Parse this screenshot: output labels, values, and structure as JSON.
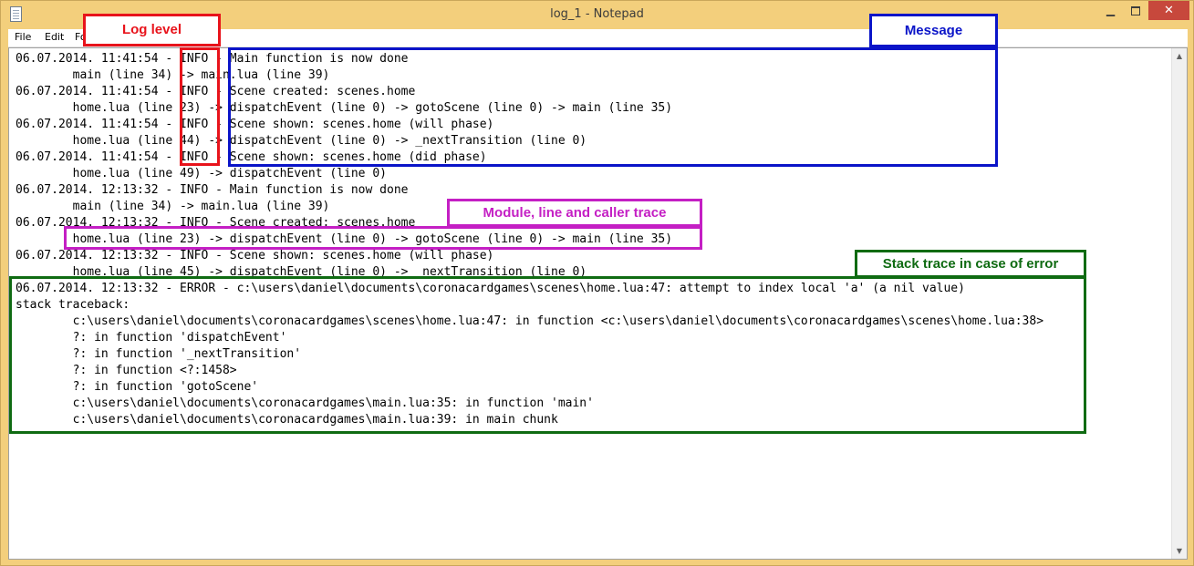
{
  "window": {
    "title": "log_1 - Notepad",
    "minimize_glyph": "▁",
    "close_glyph": "✕",
    "icon": "notepad-icon"
  },
  "menu": {
    "items": [
      "File",
      "Edit",
      "Fo"
    ]
  },
  "log": {
    "lines": [
      "06.07.2014. 11:41:54 - INFO - Main function is now done",
      "        main (line 34) -> main.lua (line 39)",
      "06.07.2014. 11:41:54 - INFO - Scene created: scenes.home",
      "        home.lua (line 23) -> dispatchEvent (line 0) -> gotoScene (line 0) -> main (line 35)",
      "06.07.2014. 11:41:54 - INFO - Scene shown: scenes.home (will phase)",
      "        home.lua (line 44) -> dispatchEvent (line 0) -> _nextTransition (line 0)",
      "06.07.2014. 11:41:54 - INFO - Scene shown: scenes.home (did phase)",
      "        home.lua (line 49) -> dispatchEvent (line 0)",
      "06.07.2014. 12:13:32 - INFO - Main function is now done",
      "        main (line 34) -> main.lua (line 39)",
      "06.07.2014. 12:13:32 - INFO - Scene created: scenes.home",
      "        home.lua (line 23) -> dispatchEvent (line 0) -> gotoScene (line 0) -> main (line 35)",
      "06.07.2014. 12:13:32 - INFO - Scene shown: scenes.home (will phase)",
      "        home.lua (line 45) -> dispatchEvent (line 0) -> _nextTransition (line 0)",
      "06.07.2014. 12:13:32 - ERROR - c:\\users\\daniel\\documents\\coronacardgames\\scenes\\home.lua:47: attempt to index local 'a' (a nil value)",
      "stack traceback:",
      "        c:\\users\\daniel\\documents\\coronacardgames\\scenes\\home.lua:47: in function <c:\\users\\daniel\\documents\\coronacardgames\\scenes\\home.lua:38>",
      "        ?: in function 'dispatchEvent'",
      "        ?: in function '_nextTransition'",
      "        ?: in function <?:1458>",
      "        ?: in function 'gotoScene'",
      "        c:\\users\\daniel\\documents\\coronacardgames\\main.lua:35: in function 'main'",
      "        c:\\users\\daniel\\documents\\coronacardgames\\main.lua:39: in main chunk"
    ]
  },
  "annotations": {
    "log_level": "Log level",
    "message": "Message",
    "module_trace": "Module, line and caller trace",
    "stack_trace": "Stack trace in case of error"
  },
  "colors": {
    "red": "#e8131b",
    "blue": "#0a14c8",
    "magenta": "#c41fc4",
    "green": "#0f6b12",
    "titlebar": "#f3cf7c",
    "close_button": "#c7483c"
  }
}
